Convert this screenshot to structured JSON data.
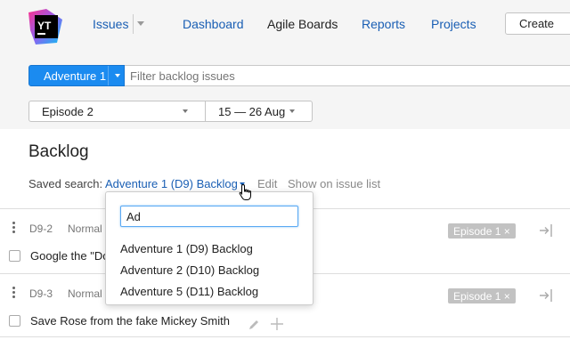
{
  "nav": {
    "items": [
      {
        "label": "Issues",
        "active": false
      },
      {
        "label": "Dashboard",
        "active": false
      },
      {
        "label": "Agile Boards",
        "active": true
      },
      {
        "label": "Reports",
        "active": false
      },
      {
        "label": "Projects",
        "active": false
      }
    ],
    "create_label": "Create",
    "logo_text": "YT",
    "issues_icon": "chevron-down-icon"
  },
  "toolbar": {
    "board_label": "Adventure 1",
    "filter_placeholder": "Filter backlog issues",
    "sprint_label": "Episode 2",
    "date_range": "15 — 26 Aug"
  },
  "backlog": {
    "title": "Backlog",
    "saved_search_label": "Saved search:",
    "saved_search_value": "Adventure 1 (D9) Backlog",
    "edit_label": "Edit",
    "show_label": "Show on issue list"
  },
  "cards": [
    {
      "id": "D9-2",
      "priority": "Normal",
      "summary": "Google the \"Do",
      "tag": "Episode 1 ×"
    },
    {
      "id": "D9-3",
      "priority": "Normal",
      "summary": "Save Rose from the fake Mickey Smith",
      "tag": "Episode 1 ×"
    }
  ],
  "dropdown": {
    "search_value": "Ad",
    "options": [
      "Adventure 1 (D9) Backlog",
      "Adventure 2 (D10) Backlog",
      "Adventure 5 (D11) Backlog"
    ]
  },
  "colors": {
    "accent": "#1b8bf0",
    "link": "#1a5fb4",
    "tag_bg": "#c2c2c2"
  }
}
